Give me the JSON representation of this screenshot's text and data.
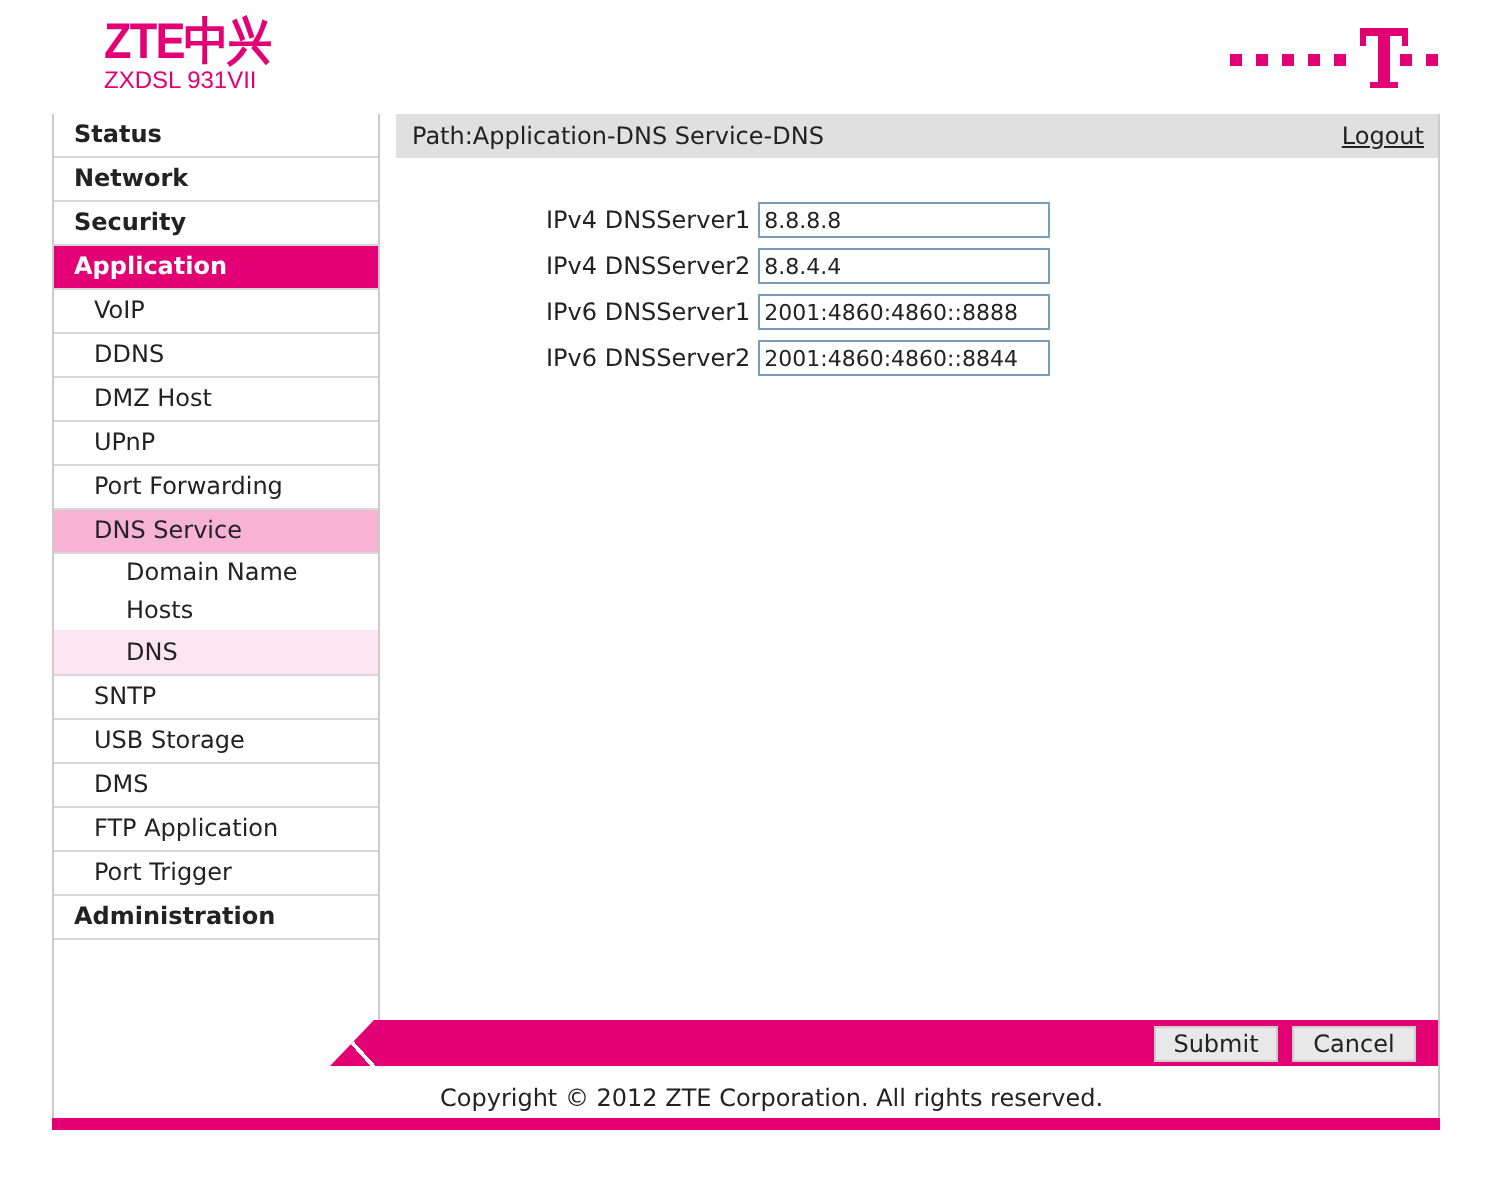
{
  "header": {
    "brand": "ZTE中兴",
    "model": "ZXDSL 931VII"
  },
  "menu": [
    {
      "label": "Status",
      "selected": false
    },
    {
      "label": "Network",
      "selected": false
    },
    {
      "label": "Security",
      "selected": false
    },
    {
      "label": "Application",
      "selected": true,
      "children": [
        {
          "label": "VoIP",
          "selected": false
        },
        {
          "label": "DDNS",
          "selected": false
        },
        {
          "label": "DMZ Host",
          "selected": false
        },
        {
          "label": "UPnP",
          "selected": false
        },
        {
          "label": "Port Forwarding",
          "selected": false
        },
        {
          "label": "DNS Service",
          "selected": true,
          "children": [
            {
              "label": "Domain Name",
              "selected": false
            },
            {
              "label": "Hosts",
              "selected": false
            },
            {
              "label": "DNS",
              "selected": true
            }
          ]
        },
        {
          "label": "SNTP",
          "selected": false
        },
        {
          "label": "USB Storage",
          "selected": false
        },
        {
          "label": "DMS",
          "selected": false
        },
        {
          "label": "FTP Application",
          "selected": false
        },
        {
          "label": "Port Trigger",
          "selected": false
        }
      ]
    },
    {
      "label": "Administration",
      "selected": false
    }
  ],
  "path": "Path:Application-DNS Service-DNS",
  "logout": "Logout",
  "fields": [
    {
      "label": "IPv4 DNSServer1",
      "value": "8.8.8.8"
    },
    {
      "label": "IPv4 DNSServer2",
      "value": "8.8.4.4"
    },
    {
      "label": "IPv6 DNSServer1",
      "value": "2001:4860:4860::8888"
    },
    {
      "label": "IPv6 DNSServer2",
      "value": "2001:4860:4860::8844"
    }
  ],
  "buttons": [
    "Submit",
    "Cancel"
  ],
  "copyright": "Copyright © 2012 ZTE Corporation. All rights reserved."
}
